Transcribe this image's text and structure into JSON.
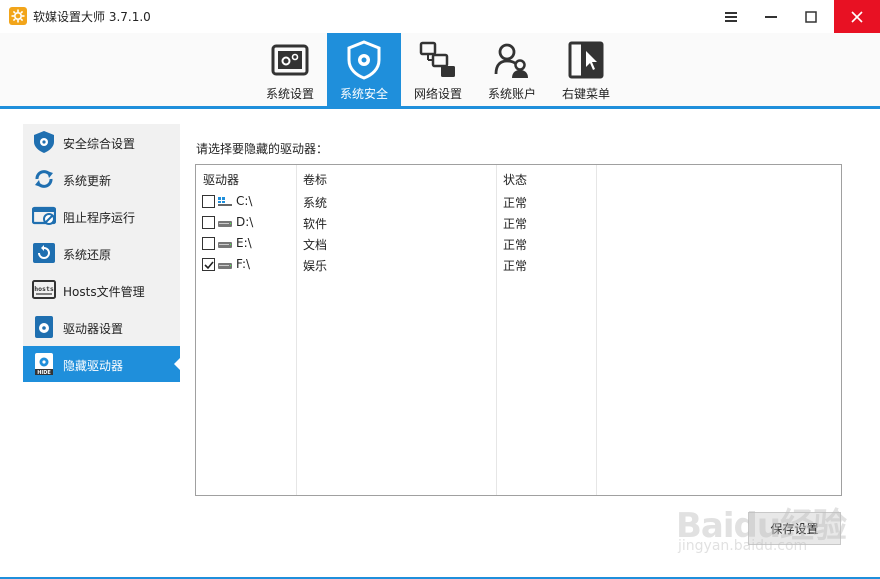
{
  "window": {
    "title": "软媒设置大师 3.7.1.0"
  },
  "toolbar": {
    "items": [
      {
        "label": "系统设置",
        "icon": "system-settings-icon"
      },
      {
        "label": "系统安全",
        "icon": "shield-gear-icon",
        "active": true
      },
      {
        "label": "网络设置",
        "icon": "network-icon"
      },
      {
        "label": "系统账户",
        "icon": "users-icon"
      },
      {
        "label": "右键菜单",
        "icon": "cursor-menu-icon"
      }
    ]
  },
  "sidebar": {
    "items": [
      {
        "label": "安全综合设置",
        "icon": "shield-icon"
      },
      {
        "label": "系统更新",
        "icon": "refresh-icon"
      },
      {
        "label": "阻止程序运行",
        "icon": "block-program-icon"
      },
      {
        "label": "系统还原",
        "icon": "restore-icon"
      },
      {
        "label": "Hosts文件管理",
        "icon": "hosts-icon"
      },
      {
        "label": "驱动器设置",
        "icon": "drive-settings-icon"
      },
      {
        "label": "隐藏驱动器",
        "icon": "hide-drive-icon",
        "active": true
      }
    ]
  },
  "main": {
    "prompt": "请选择要隐藏的驱动器：",
    "columns": [
      "驱动器",
      "卷标",
      "状态"
    ],
    "rows": [
      {
        "drive": "C:\\",
        "label": "系统",
        "status": "正常",
        "checked": false,
        "icon": "windows-drive-icon"
      },
      {
        "drive": "D:\\",
        "label": "软件",
        "status": "正常",
        "checked": false,
        "icon": "disk-drive-icon"
      },
      {
        "drive": "E:\\",
        "label": "文档",
        "status": "正常",
        "checked": false,
        "icon": "disk-drive-icon"
      },
      {
        "drive": "F:\\",
        "label": "娱乐",
        "status": "正常",
        "checked": true,
        "icon": "disk-drive-icon"
      }
    ],
    "save_label": "保存设置"
  },
  "watermark": {
    "main": "Baidu经验",
    "sub": "jingyan.baidu.com"
  },
  "colors": {
    "accent": "#1f8fdb",
    "close": "#e81123",
    "app_icon": "#f2a51a"
  }
}
